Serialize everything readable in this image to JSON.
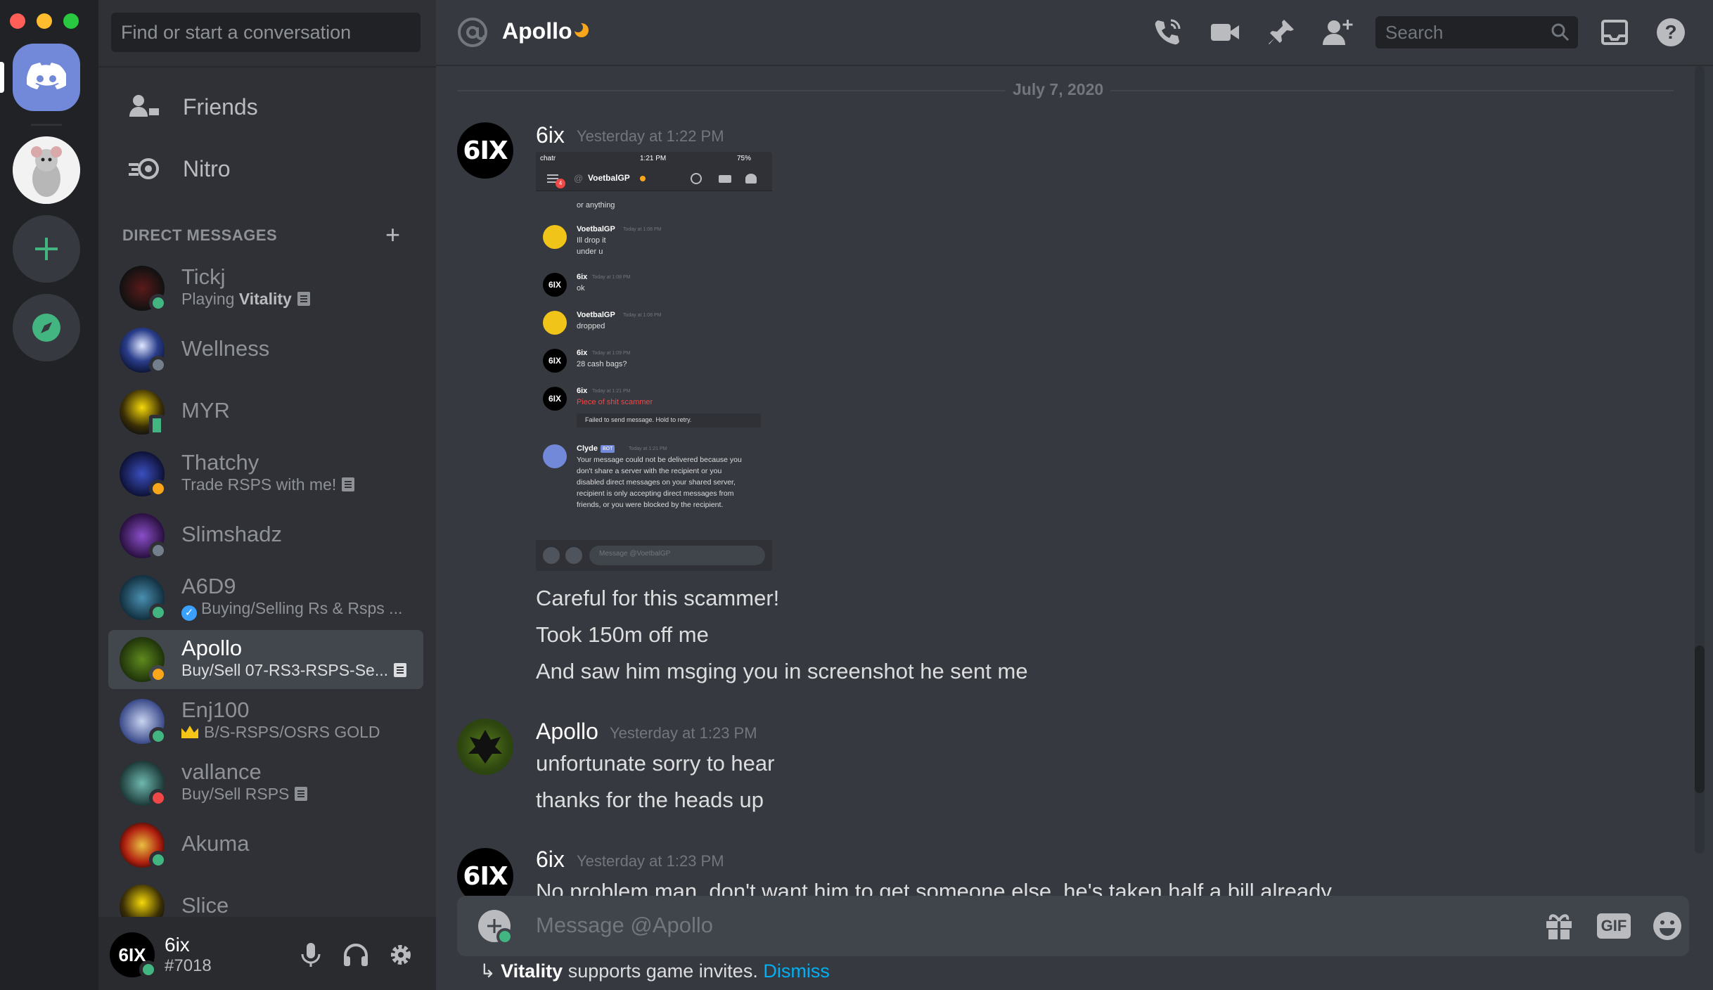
{
  "window": {
    "traffic_lights": [
      "#ff5f57",
      "#febc2e",
      "#28c840"
    ]
  },
  "colors": {
    "online": "#43b581",
    "idle": "#faa61a",
    "dnd": "#f04747",
    "offline": "#747f8d",
    "link": "#00b0f4",
    "blurple": "#7289da"
  },
  "rail": {
    "items": [
      "home-logo",
      "server-rat",
      "add-server",
      "explore-servers"
    ]
  },
  "sidebar": {
    "search_placeholder": "Find or start a conversation",
    "nav": [
      {
        "label": "Friends",
        "icon": "friends-icon"
      },
      {
        "label": "Nitro",
        "icon": "nitro-icon"
      }
    ],
    "dm_header": "DIRECT MESSAGES",
    "dms": [
      {
        "name": "Tickj",
        "sub_prefix": "Playing ",
        "sub_bold": "Vitality",
        "status": "online"
      },
      {
        "name": "Wellness",
        "sub": "",
        "status": "offline"
      },
      {
        "name": "MYR",
        "sub": "",
        "status": "mobile"
      },
      {
        "name": "Thatchy",
        "sub": "Trade RSPS with me!",
        "status": "idle"
      },
      {
        "name": "Slimshadz",
        "sub": "",
        "status": "offline"
      },
      {
        "name": "A6D9",
        "sub": "Buying/Selling Rs & Rsps ...",
        "status": "online"
      },
      {
        "name": "Apollo",
        "sub": "Buy/Sell 07-RS3-RSPS-Se...",
        "status": "idle"
      },
      {
        "name": "Enj100",
        "sub": "B/S-RSPS/OSRS GOLD",
        "status": "online"
      },
      {
        "name": "vallance",
        "sub": "Buy/Sell RSPS",
        "status": "dnd"
      },
      {
        "name": "Akuma",
        "sub": "",
        "status": "online"
      },
      {
        "name": "Slice",
        "sub": "",
        "status": "online"
      }
    ],
    "user": {
      "avatar_text": "6IX",
      "name": "6ix",
      "tag": "#7018"
    }
  },
  "header": {
    "channel": "Apollo",
    "search_placeholder": "Search"
  },
  "chat": {
    "date_divider": "July 7, 2020",
    "messages": [
      {
        "author": "6ix",
        "avatar_text": "6IX",
        "time": "Yesterday at 1:22 PM",
        "lines": [
          "Careful for this scammer!",
          "Took 150m off me",
          "And saw him msging you in screenshot he sent me"
        ]
      },
      {
        "author": "Apollo",
        "time": "Yesterday at 1:23 PM",
        "lines": [
          "unfortunate sorry to hear",
          "thanks for the heads up"
        ]
      },
      {
        "author": "6ix",
        "avatar_text": "6IX",
        "time": "Yesterday at 1:23 PM",
        "lines": [
          "No problem man, don't want him to get someone else, he's taken half a bill already"
        ]
      }
    ],
    "embed": {
      "status_left": "chatr",
      "status_time": "1:21 PM",
      "status_battery": "75%",
      "channel": "VoetbalGP",
      "top_text": "or anything",
      "items": [
        {
          "author": "VoetbalGP",
          "time": "Today at 1:08 PM",
          "lines": [
            "Ill drop it",
            "under u"
          ]
        },
        {
          "author": "6ix",
          "time": "Today at 1:08 PM",
          "lines": [
            "ok"
          ]
        },
        {
          "author": "VoetbalGP",
          "time": "Today at 1:08 PM",
          "lines": [
            "dropped"
          ]
        },
        {
          "author": "6ix",
          "time": "Today at 1:09 PM",
          "lines": [
            "28 cash bags?"
          ]
        },
        {
          "author": "6ix",
          "time": "Today at 1:21 PM",
          "lines": [
            "Piece of shit scammer"
          ]
        },
        {
          "author": "Clyde",
          "time": "Today at 1:21 PM",
          "lines": [
            "Your message could not be delivered because you",
            "don't share a server with the recipient or you",
            "disabled direct messages on your shared server,",
            "recipient is only accepting direct messages from",
            "friends, or you were blocked by the recipient."
          ]
        }
      ],
      "failed_text": "Failed to send message. Hold to retry.",
      "bot_badge": "BOT",
      "composer_placeholder": "Message @VoetbalGP"
    }
  },
  "composer": {
    "placeholder": "Message @Apollo",
    "gif_label": "GIF"
  },
  "invite": {
    "arrow": "↳",
    "game": "Vitality",
    "text": " supports game invites. ",
    "dismiss": "Dismiss"
  }
}
